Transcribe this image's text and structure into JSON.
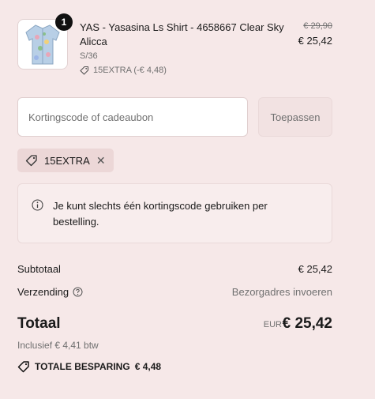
{
  "product": {
    "quantity": "1",
    "title": "YAS - Yasasina Ls Shirt - 4658667 Clear Sky Alicca",
    "variant": "S/36",
    "discount": "15EXTRA (-€ 4,48)",
    "price_original": "€ 29,90",
    "price_current": "€ 25,42",
    "image_icon": "shirt-image"
  },
  "discount_form": {
    "placeholder": "Kortingscode of cadeaubon",
    "value": "",
    "apply_label": "Toepassen"
  },
  "applied_code": {
    "code": "15EXTRA",
    "icon": "tag-icon",
    "remove_icon": "close-icon"
  },
  "notice": {
    "icon": "info-icon",
    "text": "Je kunt slechts één kortingscode gebruiken per bestelling."
  },
  "summary": {
    "subtotal_label": "Subtotaal",
    "subtotal_value": "€ 25,42",
    "shipping_label": "Verzending",
    "shipping_value": "Bezorgadres invoeren",
    "total_label": "Totaal",
    "total_currency": "EUR",
    "total_value": "€ 25,42",
    "tax_note": "Inclusief € 4,41 btw",
    "savings_label": "TOTALE BESPARING",
    "savings_value": "€ 4,48"
  },
  "colors": {
    "background": "#f6e8e8",
    "text": "#1a1a1a",
    "muted": "#707070",
    "badge": "#111111"
  }
}
